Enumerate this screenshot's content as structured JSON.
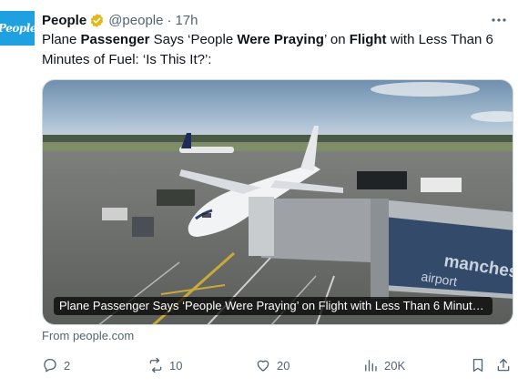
{
  "account": {
    "avatar_text": "People",
    "avatar_color": "#1fa0e0",
    "name": "People",
    "handle": "@people",
    "separator": "·",
    "time": "17h",
    "verified_color": "#e2b719"
  },
  "tweet": {
    "parts": [
      {
        "text": "Plane ",
        "bold": false
      },
      {
        "text": "Passenger",
        "bold": true
      },
      {
        "text": " Says ‘People ",
        "bold": false
      },
      {
        "text": "Were Praying",
        "bold": true
      },
      {
        "text": "’ on ",
        "bold": false
      },
      {
        "text": "Flight",
        "bold": true
      },
      {
        "text": " with Less Than 6 Minutes of Fuel: ‘Is This It?’:",
        "bold": false
      }
    ]
  },
  "media": {
    "caption": "Plane Passenger Says ‘People Were Praying’ on Flight with Less Than 6 Minute...",
    "bridge_text_1": "manchester",
    "bridge_text_2": "airport"
  },
  "link": {
    "source": "From people.com"
  },
  "actions": {
    "replies": "2",
    "reposts": "10",
    "likes": "20",
    "views": "20K"
  }
}
